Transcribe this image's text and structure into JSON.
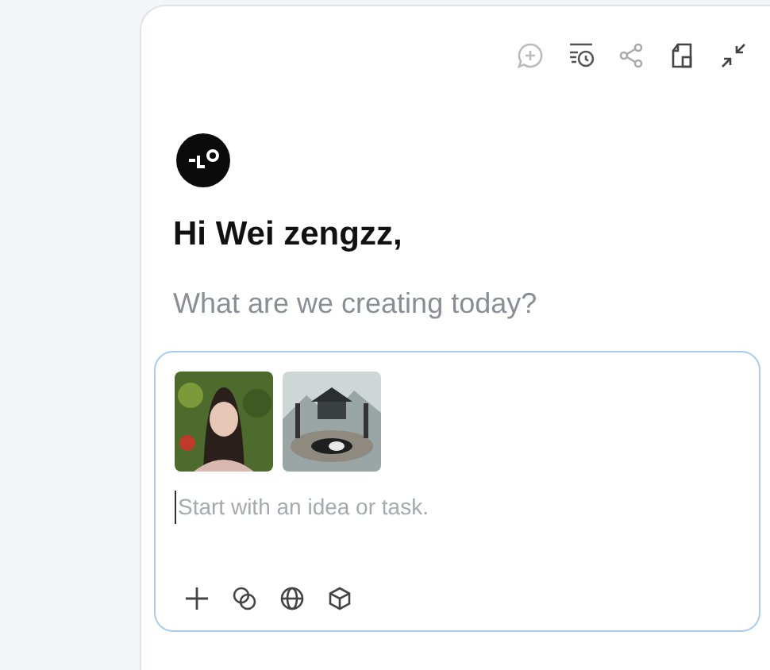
{
  "greeting": "Hi Wei zengzz,",
  "subtitle": "What are we creating today?",
  "prompt": {
    "placeholder": "Start with an idea or task."
  }
}
